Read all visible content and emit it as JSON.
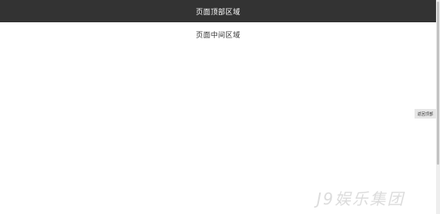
{
  "header": {
    "title": "页面顶部区域"
  },
  "main": {
    "title": "页面中间区域"
  },
  "back_to_top": {
    "label": "返回顶部"
  },
  "watermark": {
    "text": "J9娱乐集团"
  },
  "colors": {
    "header_bg": "#333333",
    "header_text": "#ffffff",
    "body_bg": "#ffffff"
  }
}
